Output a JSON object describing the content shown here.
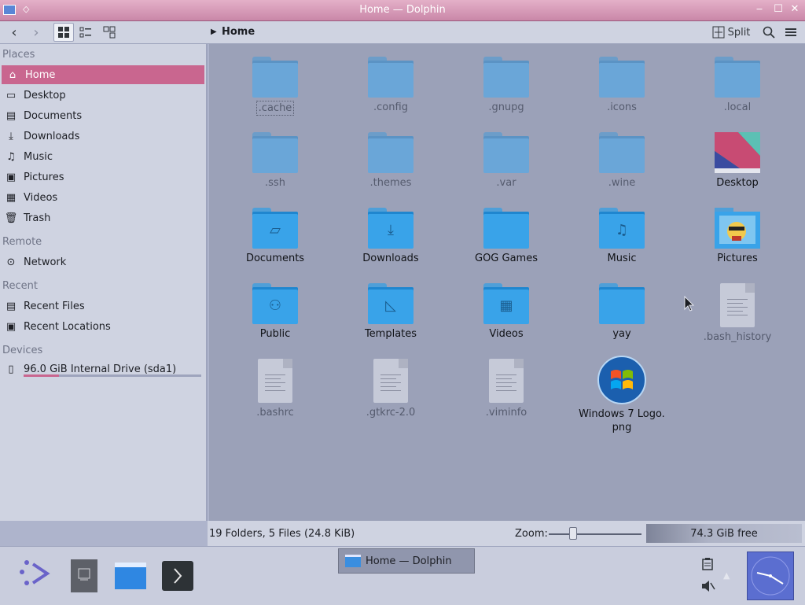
{
  "window": {
    "title": "Home — Dolphin"
  },
  "toolbar": {
    "breadcrumb": "Home",
    "split_label": "Split"
  },
  "sidebar": {
    "sections": [
      {
        "title": "Places"
      },
      {
        "title": "Remote"
      },
      {
        "title": "Recent"
      },
      {
        "title": "Devices"
      }
    ],
    "places": [
      "Home",
      "Desktop",
      "Documents",
      "Downloads",
      "Music",
      "Pictures",
      "Videos",
      "Trash"
    ],
    "remote": [
      "Network"
    ],
    "recent": [
      "Recent Files",
      "Recent Locations"
    ],
    "devices": [
      "96.0 GiB Internal Drive (sda1)"
    ],
    "drive_usage_fraction": 0.2
  },
  "files": [
    {
      "name": ".cache",
      "kind": "folder-hidden"
    },
    {
      "name": ".config",
      "kind": "folder-hidden"
    },
    {
      "name": ".gnupg",
      "kind": "folder-hidden"
    },
    {
      "name": ".icons",
      "kind": "folder-hidden"
    },
    {
      "name": ".local",
      "kind": "folder-hidden"
    },
    {
      "name": ".ssh",
      "kind": "folder-hidden"
    },
    {
      "name": ".themes",
      "kind": "folder-hidden"
    },
    {
      "name": ".var",
      "kind": "folder-hidden"
    },
    {
      "name": ".wine",
      "kind": "folder-hidden"
    },
    {
      "name": "Desktop",
      "kind": "desktop"
    },
    {
      "name": "Documents",
      "kind": "folder",
      "glyph": "▱"
    },
    {
      "name": "Downloads",
      "kind": "folder",
      "glyph": "⤓"
    },
    {
      "name": "GOG Games",
      "kind": "folder",
      "glyph": ""
    },
    {
      "name": "Music",
      "kind": "folder",
      "glyph": "♫"
    },
    {
      "name": "Pictures",
      "kind": "pictures"
    },
    {
      "name": "Public",
      "kind": "folder",
      "glyph": "⚇"
    },
    {
      "name": "Templates",
      "kind": "folder",
      "glyph": "◺"
    },
    {
      "name": "Videos",
      "kind": "folder",
      "glyph": "▦"
    },
    {
      "name": "yay",
      "kind": "folder",
      "glyph": ""
    },
    {
      "name": ".bash_history",
      "kind": "doc-hidden"
    },
    {
      "name": ".bashrc",
      "kind": "doc-hidden"
    },
    {
      "name": ".gtkrc-2.0",
      "kind": "doc-hidden"
    },
    {
      "name": ".viminfo",
      "kind": "doc-hidden"
    },
    {
      "name": "Windows 7 Logo.\npng",
      "kind": "logo"
    }
  ],
  "statusbar": {
    "summary": "19 Folders, 5 Files (24.8 KiB)",
    "zoom_label": "Zoom:",
    "free_space": "74.3 GiB free"
  },
  "taskbar": {
    "task_label": "Home — Dolphin"
  },
  "colors": {
    "accent": "#c9668f",
    "folder": "#39a3e9"
  }
}
